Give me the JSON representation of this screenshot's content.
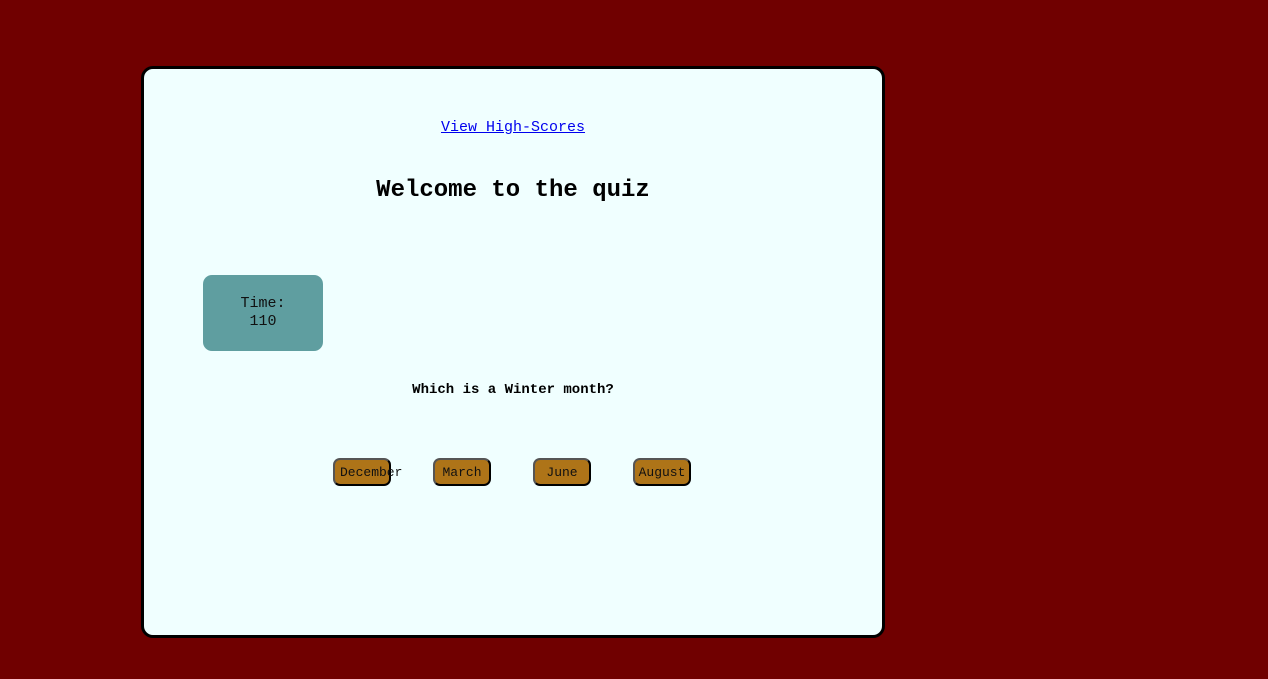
{
  "header": {
    "highscores_link": "View High-Scores",
    "title": "Welcome to the quiz"
  },
  "timer": {
    "label": "Time:",
    "value": "110"
  },
  "quiz": {
    "question": "Which is a Winter month?",
    "answers": [
      "December",
      "March",
      "June",
      "August"
    ]
  },
  "colors": {
    "background": "#700000",
    "card": "#f0ffff",
    "timer": "#5f9ea0",
    "button": "#ae7418",
    "link": "#0000ee"
  }
}
